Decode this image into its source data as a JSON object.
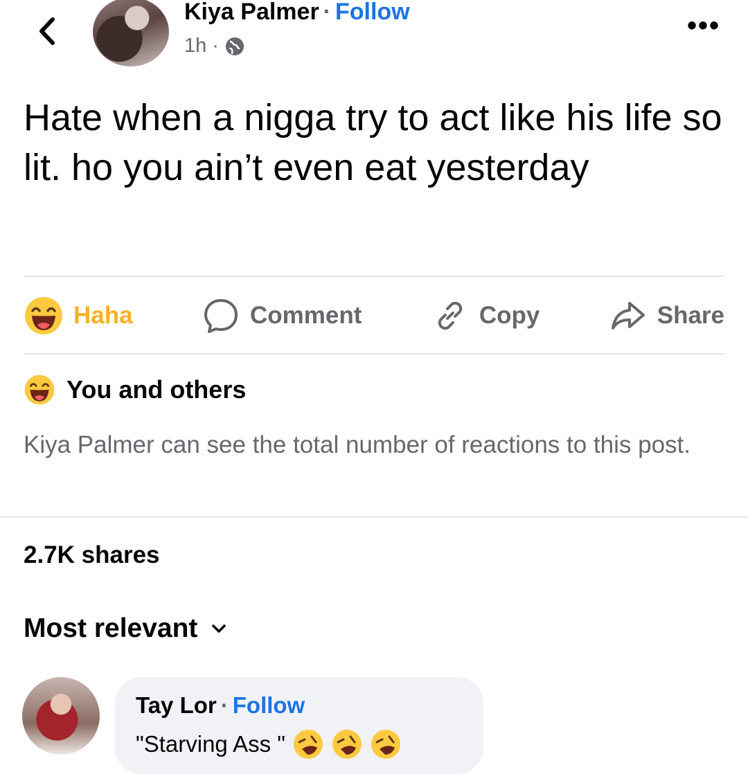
{
  "post": {
    "author": "Kiya Palmer",
    "follow_label": "Follow",
    "separator": "·",
    "time": "1h",
    "time_separator": "·",
    "audience_icon": "globe-icon",
    "more_label": "•••",
    "text": "Hate when a nigga try to act like his life so lit. ho you ain’t even eat yesterday"
  },
  "actions": {
    "haha_label": "Haha",
    "comment_label": "Comment",
    "copy_label": "Copy",
    "share_label": "Share"
  },
  "reactions": {
    "summary": "You and others",
    "note": "Kiya Palmer can see the total number of reactions to this post."
  },
  "shares": {
    "count_label": "2.7K shares"
  },
  "comments": {
    "sort_label": "Most relevant",
    "items": [
      {
        "author": "Tay Lor",
        "separator": "·",
        "follow_label": "Follow",
        "text": "\"Starving Ass \"",
        "emoji": "rolling-laughing-emoji"
      }
    ]
  },
  "colors": {
    "follow_blue": "#1b74e4",
    "haha_yellow": "#f7b125",
    "muted_gray": "#65676b",
    "bubble_bg": "#f0f2f5"
  }
}
